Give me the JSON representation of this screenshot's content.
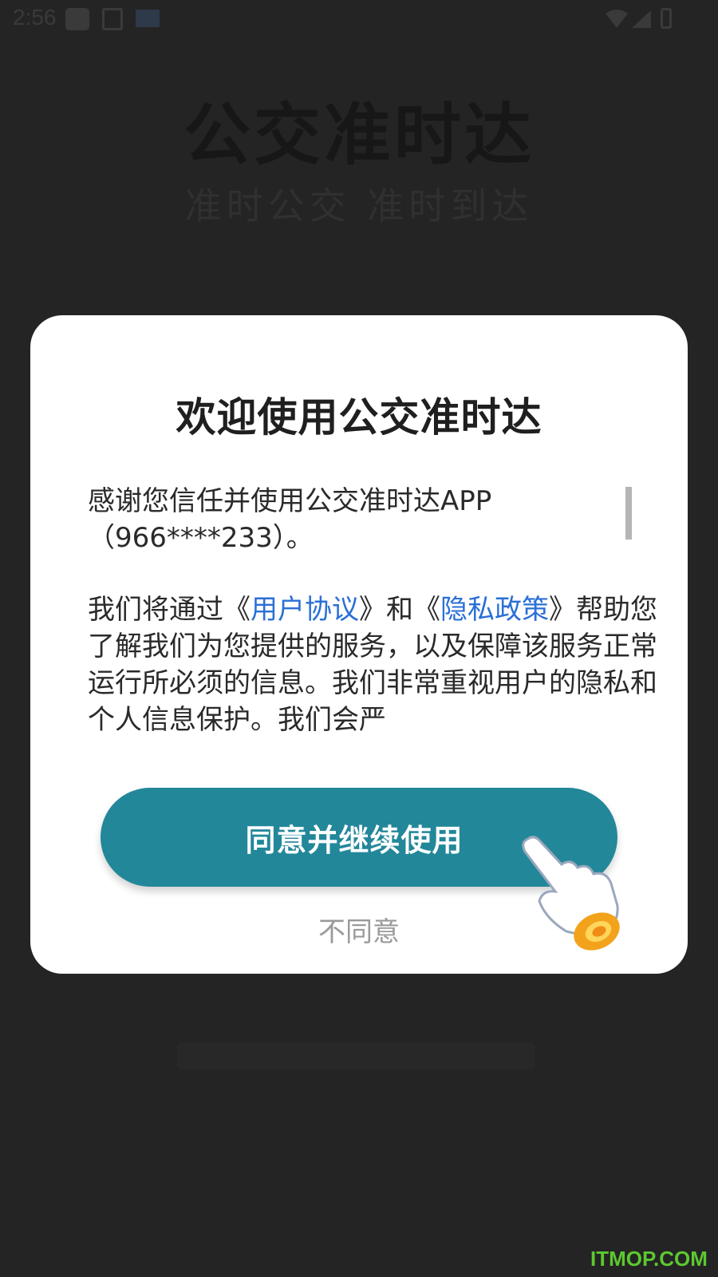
{
  "status_bar": {
    "time": "2:56"
  },
  "background": {
    "app_title": "公交准时达",
    "app_slogan": "准时公交 准时到达"
  },
  "dialog": {
    "title": "欢迎使用公交准时达",
    "para1_text": "感谢您信任并使用公交准时达APP（966****233）。",
    "para2": {
      "t1": "我们将通过《",
      "user_agreement_link": "用户协议",
      "t2": "》和《",
      "privacy_policy_link": "隐私政策",
      "t3": "》帮助您了解我们为您提供的服务，以及保障该服务正常运行所必须的信息。我们非常重视用户的隐私和个人信息保护。我们会严"
    },
    "agree_button": "同意并继续使用",
    "disagree_link": "不同意"
  },
  "watermark": "ITMOP.COM",
  "colors": {
    "background": "#242424",
    "accent_button": "#23879a",
    "link": "#2a6fd6"
  },
  "icons": [
    "wifi-icon",
    "signal-icon",
    "battery-icon",
    "pointing-hand-icon"
  ]
}
